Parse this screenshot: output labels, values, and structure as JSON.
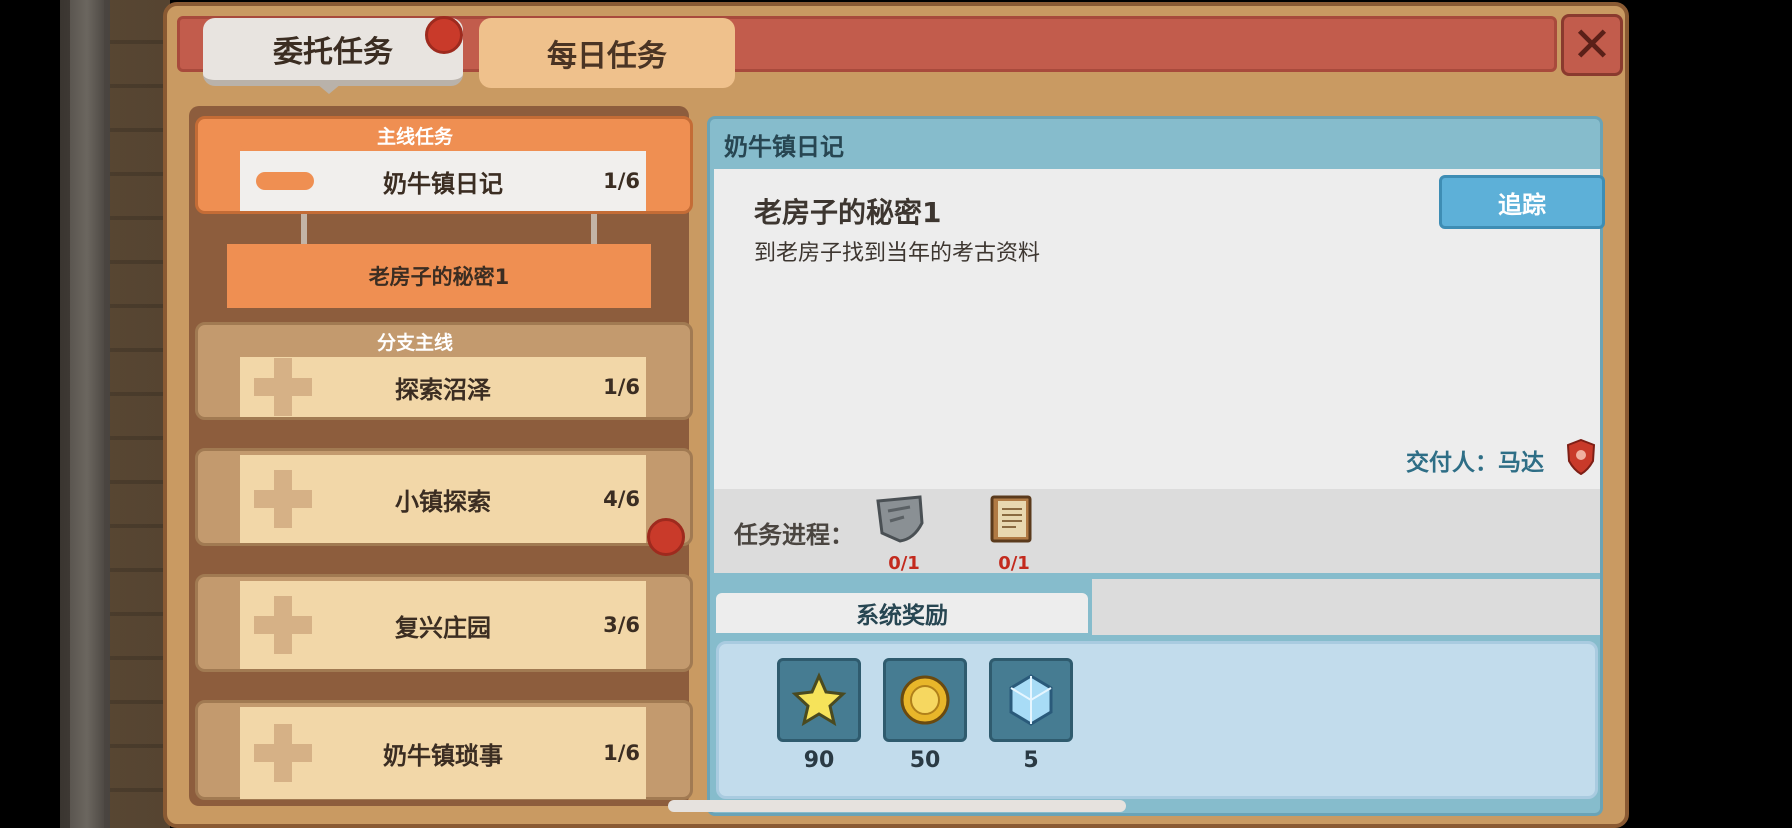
{
  "tabs": {
    "commission": "委托任务",
    "daily": "每日任务"
  },
  "close_label": "✕",
  "quest_list": {
    "main": {
      "header": "主线任务",
      "title": "奶牛镇日记",
      "count": "1/6",
      "subitem": "老房子的秘密1"
    },
    "branches": [
      {
        "header": "分支主线",
        "title": "探索沼泽",
        "count": "1/6"
      },
      {
        "title": "小镇探索",
        "count": "4/6"
      },
      {
        "title": "复兴庄园",
        "count": "3/6"
      },
      {
        "title": "奶牛镇琐事",
        "count": "1/6"
      }
    ]
  },
  "detail": {
    "section_title": "奶牛镇日记",
    "task_name": "老房子的秘密1",
    "task_desc": "到老房子找到当年的考古资料",
    "track_label": "追踪",
    "giver": "交付人：马达",
    "progress_label": "任务进程：",
    "progress_items": [
      {
        "icon": "stone-tablet-icon",
        "count": "0/1"
      },
      {
        "icon": "book-icon",
        "count": "0/1"
      }
    ],
    "reward_tab": "系统奖励",
    "rewards": [
      {
        "icon": "star-icon",
        "amount": "90"
      },
      {
        "icon": "gold-coin-icon",
        "amount": "50"
      },
      {
        "icon": "blue-gem-icon",
        "amount": "5"
      }
    ]
  },
  "colors": {
    "accent_orange": "#ef8f52",
    "header_red": "#c25c4c",
    "notification_red": "#c93a2a",
    "detail_blue": "#86bccc",
    "button_blue": "#5db0d8"
  }
}
